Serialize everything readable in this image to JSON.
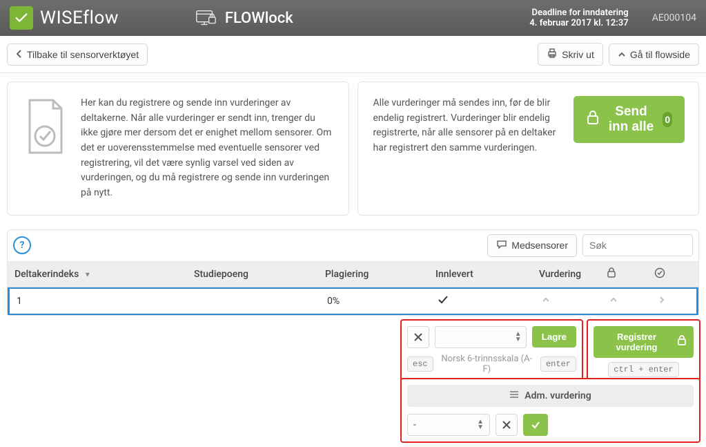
{
  "header": {
    "brand": "WISEflow",
    "app": "FLOWlock",
    "deadline_label": "Deadline for inndatering",
    "deadline_value": "4. februar 2017 kl. 12:37",
    "user_id": "AE000104"
  },
  "toolbar": {
    "back": "Tilbake til sensorverktøyet",
    "print": "Skriv ut",
    "goto_flow": "Gå til flowside"
  },
  "info": {
    "left": "Her kan du registrere og sende inn vurderinger av deltakerne. Når alle vurderinger er sendt inn, trenger du ikke gjøre mer dersom det er enighet mellom sensorer. Om det er uoverensstemmelse med eventuelle sensorer ved registrering, vil det være synlig varsel ved siden av vurderingen, og du må registrere og sende inn vurderingen på nytt.",
    "right": "Alle vurderinger må sendes inn, før de blir endelig registrert. Vurderinger blir endelig registrerte, når alle sensorer på en deltaker har registrert den samme vurderingen.",
    "send_all": "Send inn alle",
    "send_all_count": "0"
  },
  "controls": {
    "medsensorer": "Medsensorer",
    "search_placeholder": "Søk"
  },
  "columns": {
    "index": "Deltakerindeks",
    "credits": "Studiepoeng",
    "plag": "Plagiering",
    "delivered": "Innlevert",
    "grade": "Vurdering"
  },
  "row": {
    "index": "1",
    "plag": "0%"
  },
  "popover": {
    "lagre": "Lagre",
    "esc": "esc",
    "scale": "Norsk 6-trinnsskala (A-F)",
    "enter": "enter",
    "register": "Registrer vurdering",
    "ctrl_enter": "ctrl + enter",
    "adm_title": "Adm. vurdering",
    "select_value": "-"
  }
}
